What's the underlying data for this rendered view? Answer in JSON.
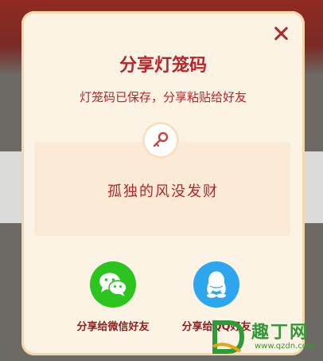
{
  "dialog": {
    "title": "分享灯笼码",
    "subtitle": "灯笼码已保存，分享粘贴给好友",
    "code": "孤独的风没发财",
    "close_icon": "close-icon",
    "key_icon": "key-icon"
  },
  "share": {
    "wechat_label": "分享给微信好友",
    "qq_label": "分享给QQ好友",
    "wechat_icon": "wechat-icon",
    "qq_icon": "qq-icon"
  },
  "watermark": {
    "text": "趣丁网",
    "url": "www.qzdn.com"
  },
  "colors": {
    "accent": "#b8252a",
    "wechat": "#2cc51f",
    "qq": "#2ea6ee",
    "dialog_bg": "#fdf3e4"
  }
}
